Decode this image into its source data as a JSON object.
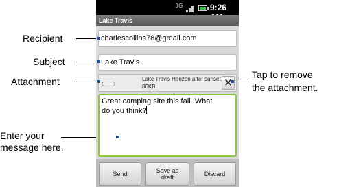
{
  "status_bar": {
    "network": "3G",
    "time": "9:26 AM"
  },
  "app": {
    "title": "Lake Travis"
  },
  "compose": {
    "to_value": "charlescollins78@gmail.com",
    "subject_value": "Lake Travis",
    "attachment": {
      "name": "Lake Travis Horizon after sunset.",
      "size": "86KB",
      "remove_label": "×"
    },
    "body_line1": "Great camping site this fall. What",
    "body_line2": "do you think?"
  },
  "buttons": {
    "send": "Send",
    "save_draft_line1": "Save as",
    "save_draft_line2": "draft",
    "discard": "Discard"
  },
  "callouts": {
    "recipient": "Recipient",
    "subject": "Subject",
    "attachment": "Attachment",
    "remove_line1": "Tap to remove",
    "remove_line2": "the attachment.",
    "message_line1": "Enter your",
    "message_line2": "message here."
  },
  "colors": {
    "focus_border": "#8cc63f",
    "callout_dot": "#1f4fa0",
    "battery": "#39c34a"
  }
}
